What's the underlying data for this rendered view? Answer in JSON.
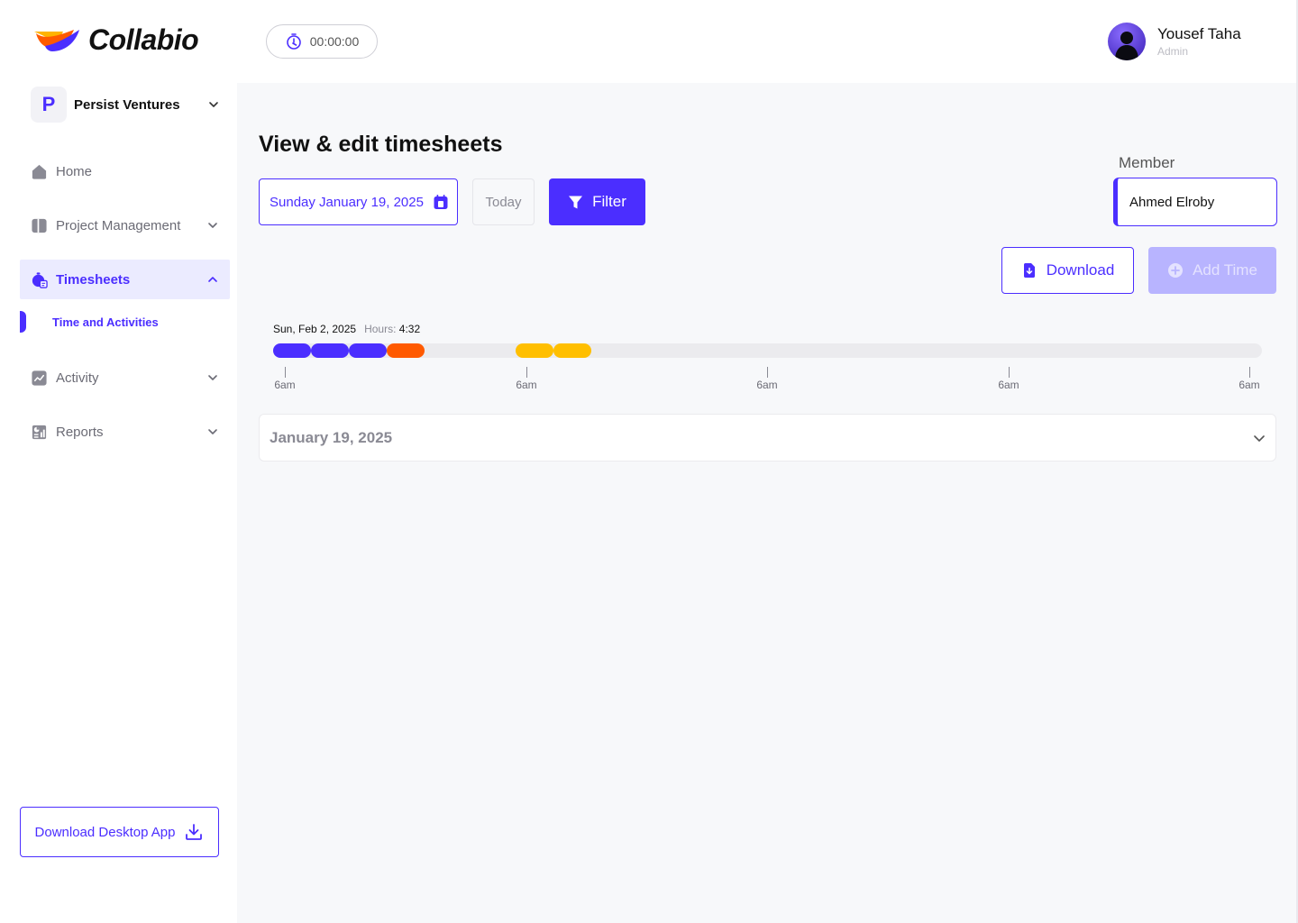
{
  "app": {
    "name": "Collabio",
    "brand_color": "#4b2eff"
  },
  "header": {
    "timer": "00:00:00",
    "user": {
      "name": "Yousef Taha",
      "role": "Admin"
    }
  },
  "sidebar": {
    "org": {
      "badge": "P",
      "name": "Persist Ventures"
    },
    "items": [
      {
        "label": "Home",
        "icon": "home-icon",
        "expandable": false
      },
      {
        "label": "Project Management",
        "icon": "project-icon",
        "expandable": true
      },
      {
        "label": "Timesheets",
        "icon": "timesheet-icon",
        "expandable": true,
        "active": true
      },
      {
        "label": "Activity",
        "icon": "activity-icon",
        "expandable": true
      },
      {
        "label": "Reports",
        "icon": "reports-icon",
        "expandable": true
      }
    ],
    "sub_item": {
      "label": "Time and Activities"
    },
    "download_app": "Download Desktop App"
  },
  "main": {
    "title": "View & edit timesheets",
    "date": "Sunday January 19, 2025",
    "today": "Today",
    "filter": "Filter",
    "member": {
      "label": "Member",
      "value": "Ahmed Elroby"
    },
    "download": "Download",
    "add_time": "Add Time",
    "timeline": {
      "date": "Sun, Feb 2, 2025",
      "hours_label": "Hours:",
      "hours": "4:32",
      "segments": [
        {
          "color": "#4b2eff"
        },
        {
          "color": "#4b2eff"
        },
        {
          "color": "#4b2eff"
        },
        {
          "color": "#ff5a00"
        },
        {
          "color": "#ffbf00"
        },
        {
          "color": "#ffbf00"
        }
      ],
      "ticks": [
        "6am",
        "6am",
        "6am",
        "6am",
        "6am"
      ]
    },
    "accordion": {
      "label": "January 19, 2025"
    }
  }
}
